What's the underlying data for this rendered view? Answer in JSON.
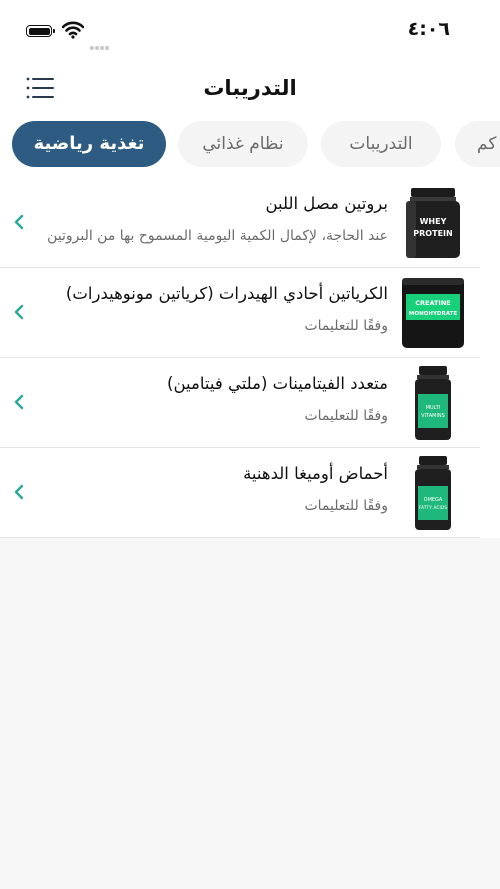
{
  "status_bar": {
    "time": "٤:٠٦"
  },
  "header": {
    "title": "التدريبات",
    "menu_icon": "hamburger-menu-icon"
  },
  "tabs": [
    {
      "label": "تغذية رياضية",
      "active": true
    },
    {
      "label": "نظام غذائي",
      "active": false
    },
    {
      "label": "التدريبات",
      "active": false
    },
    {
      "label": "كم",
      "active": false
    }
  ],
  "products": [
    {
      "name": "بروتين مصل اللبن",
      "desc": "عند الحاجة، لإكمال الكمية اليومية المسموح بها من البروتين",
      "label": "WHEY PROTEIN",
      "label_color": "#111111",
      "accent": "#ffffff"
    },
    {
      "name": "الكرياتين أحادي الهيدرات (كرياتين مونوهيدرات)",
      "desc": "وفقًا للتعليمات",
      "label": "CREATINE MONOHYDRATE",
      "label_color": "#19d07a",
      "accent": "#ffffff"
    },
    {
      "name": "متعدد الفيتامينات (ملتي فيتامين)",
      "desc": "وفقًا للتعليمات",
      "label": "MULTI VITAMINS",
      "label_color": "#1fb87c",
      "accent": "#ffffff"
    },
    {
      "name": "أحماض أوميغا الدهنية",
      "desc": "وفقًا للتعليمات",
      "label": "OMEGA FATTY ACIDS",
      "label_color": "#1fb87c",
      "accent": "#ffffff"
    }
  ],
  "colors": {
    "accent": "#2d5b82",
    "chevron": "#2aa89a"
  }
}
